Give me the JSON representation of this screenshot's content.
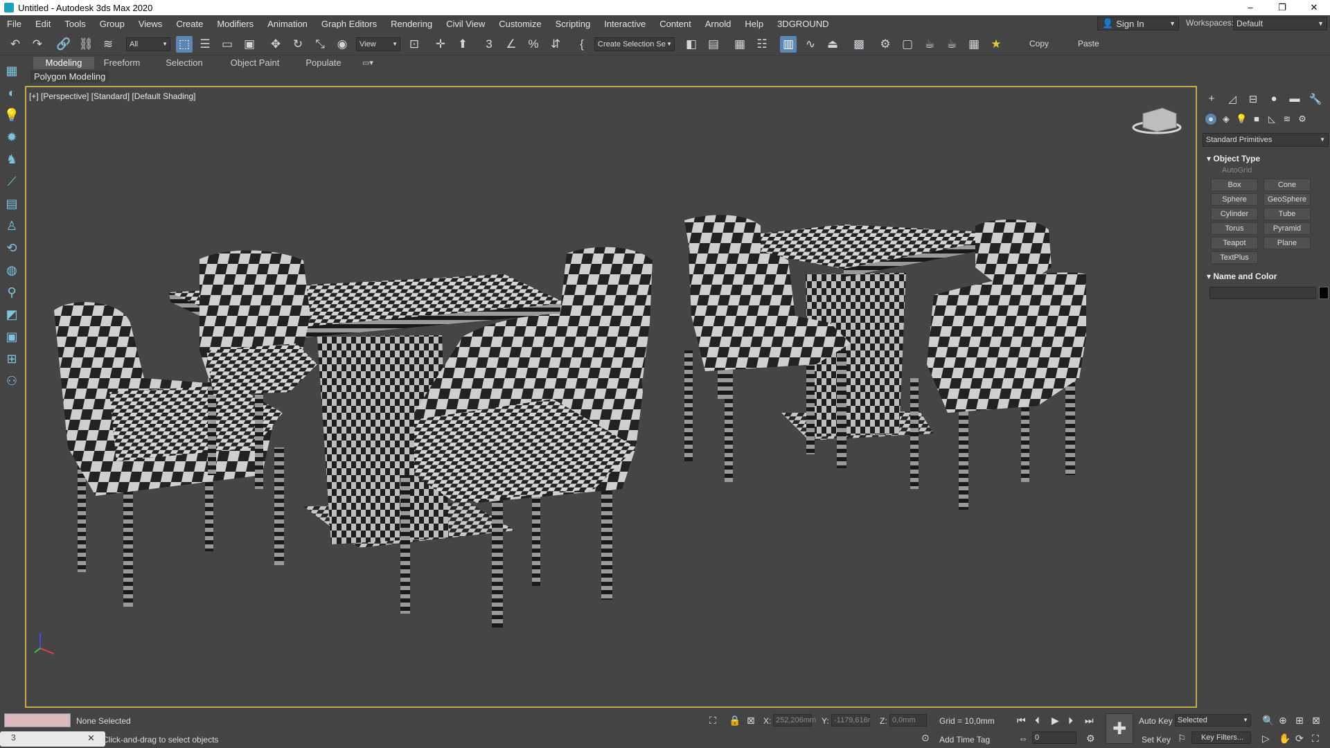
{
  "window": {
    "title": "Untitled - Autodesk 3ds Max 2020",
    "minimize": "–",
    "maximize": "❐",
    "close": "✕"
  },
  "menu": {
    "items": [
      "File",
      "Edit",
      "Tools",
      "Group",
      "Views",
      "Create",
      "Modifiers",
      "Animation",
      "Graph Editors",
      "Rendering",
      "Civil View",
      "Customize",
      "Scripting",
      "Interactive",
      "Content",
      "Arnold",
      "Help",
      "3DGROUND"
    ],
    "sign_in": "Sign In",
    "workspaces_label": "Workspaces:",
    "workspaces_value": "Default"
  },
  "toolbar": {
    "selection_filter": "All",
    "reference_coord": "View",
    "selection_set": "Create Selection Se",
    "copy_label": "Copy",
    "paste_label": "Paste"
  },
  "ribbon": {
    "tabs": [
      "Modeling",
      "Freeform",
      "Selection",
      "Object Paint",
      "Populate"
    ],
    "active_tab": "Modeling",
    "subtab": "Polygon Modeling"
  },
  "viewport": {
    "label": "[+] [Perspective] [Standard] [Default Shading]"
  },
  "command_panel": {
    "category": "Standard Primitives",
    "object_type_title": "Object Type",
    "autogrid": "AutoGrid",
    "buttons": [
      "Box",
      "Cone",
      "Sphere",
      "GeoSphere",
      "Cylinder",
      "Tube",
      "Torus",
      "Pyramid",
      "Teapot",
      "Plane",
      "TextPlus"
    ],
    "name_and_color_title": "Name and Color",
    "object_color": "#000000"
  },
  "status": {
    "selection": "None Selected",
    "prompt": "Click-and-drag to select objects",
    "x_label": "X:",
    "x_value": "252,206mm",
    "y_label": "Y:",
    "y_value": "-1179,616r",
    "z_label": "Z:",
    "z_value": "0,0mm",
    "grid": "Grid = 10,0mm",
    "add_time_tag": "Add Time Tag",
    "auto_key": "Auto Key",
    "key_mode": "Selected",
    "set_key": "Set Key",
    "key_filters": "Key Filters...",
    "frame": "0"
  }
}
